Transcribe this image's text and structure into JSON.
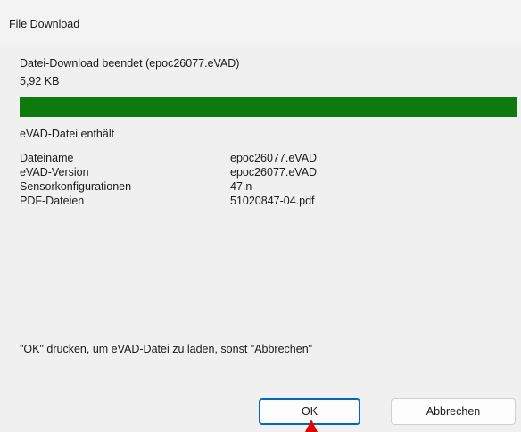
{
  "window": {
    "title": "File Download"
  },
  "status": {
    "message": "Datei-Download beendet (epoc26077.eVAD)",
    "size": "5,92 KB",
    "progress_percent": 100,
    "progress_color": "#0e7a0d"
  },
  "contents": {
    "heading": "eVAD-Datei enthält",
    "rows": [
      {
        "label": "Dateiname",
        "value": "epoc26077.eVAD"
      },
      {
        "label": "eVAD-Version",
        "value": "epoc26077.eVAD"
      },
      {
        "label": "Sensorkonfigurationen",
        "value": "47.n"
      },
      {
        "label": "PDF-Dateien",
        "value": "51020847-04.pdf"
      }
    ]
  },
  "instruction": "\"OK\" drücken, um eVAD-Datei zu laden, sonst \"Abbrechen\"",
  "buttons": {
    "ok_label": "OK",
    "cancel_label": "Abbrechen"
  },
  "accent_color": "#0067c0",
  "cursor_icon": "mouse-pointer-icon"
}
